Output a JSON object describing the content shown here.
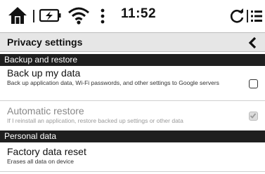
{
  "status_bar": {
    "time": "11:52",
    "icons": [
      "home-icon",
      "battery-icon",
      "wifi-icon",
      "more-vertical-icon",
      "refresh-icon",
      "menu-icon"
    ]
  },
  "header": {
    "title": "Privacy settings",
    "back_icon": "chevron-left-icon"
  },
  "sections": [
    {
      "title": "Backup and restore",
      "items": [
        {
          "title": "Back up my data",
          "summary": "Back up application data, Wi-Fi passwords, and other settings to Google servers",
          "checked": false,
          "enabled": true
        },
        {
          "title": "Automatic restore",
          "summary": "If I reinstall an application, restore backed up settings or other data",
          "checked": true,
          "enabled": false
        }
      ]
    },
    {
      "title": "Personal data",
      "items": [
        {
          "title": "Factory data reset",
          "summary": "Erases all data on device"
        }
      ]
    }
  ],
  "colors": {
    "header_bg": "#e6e6e6",
    "section_bg": "#1f1f1f",
    "section_text": "#ffffff",
    "disabled_text": "#888888"
  }
}
